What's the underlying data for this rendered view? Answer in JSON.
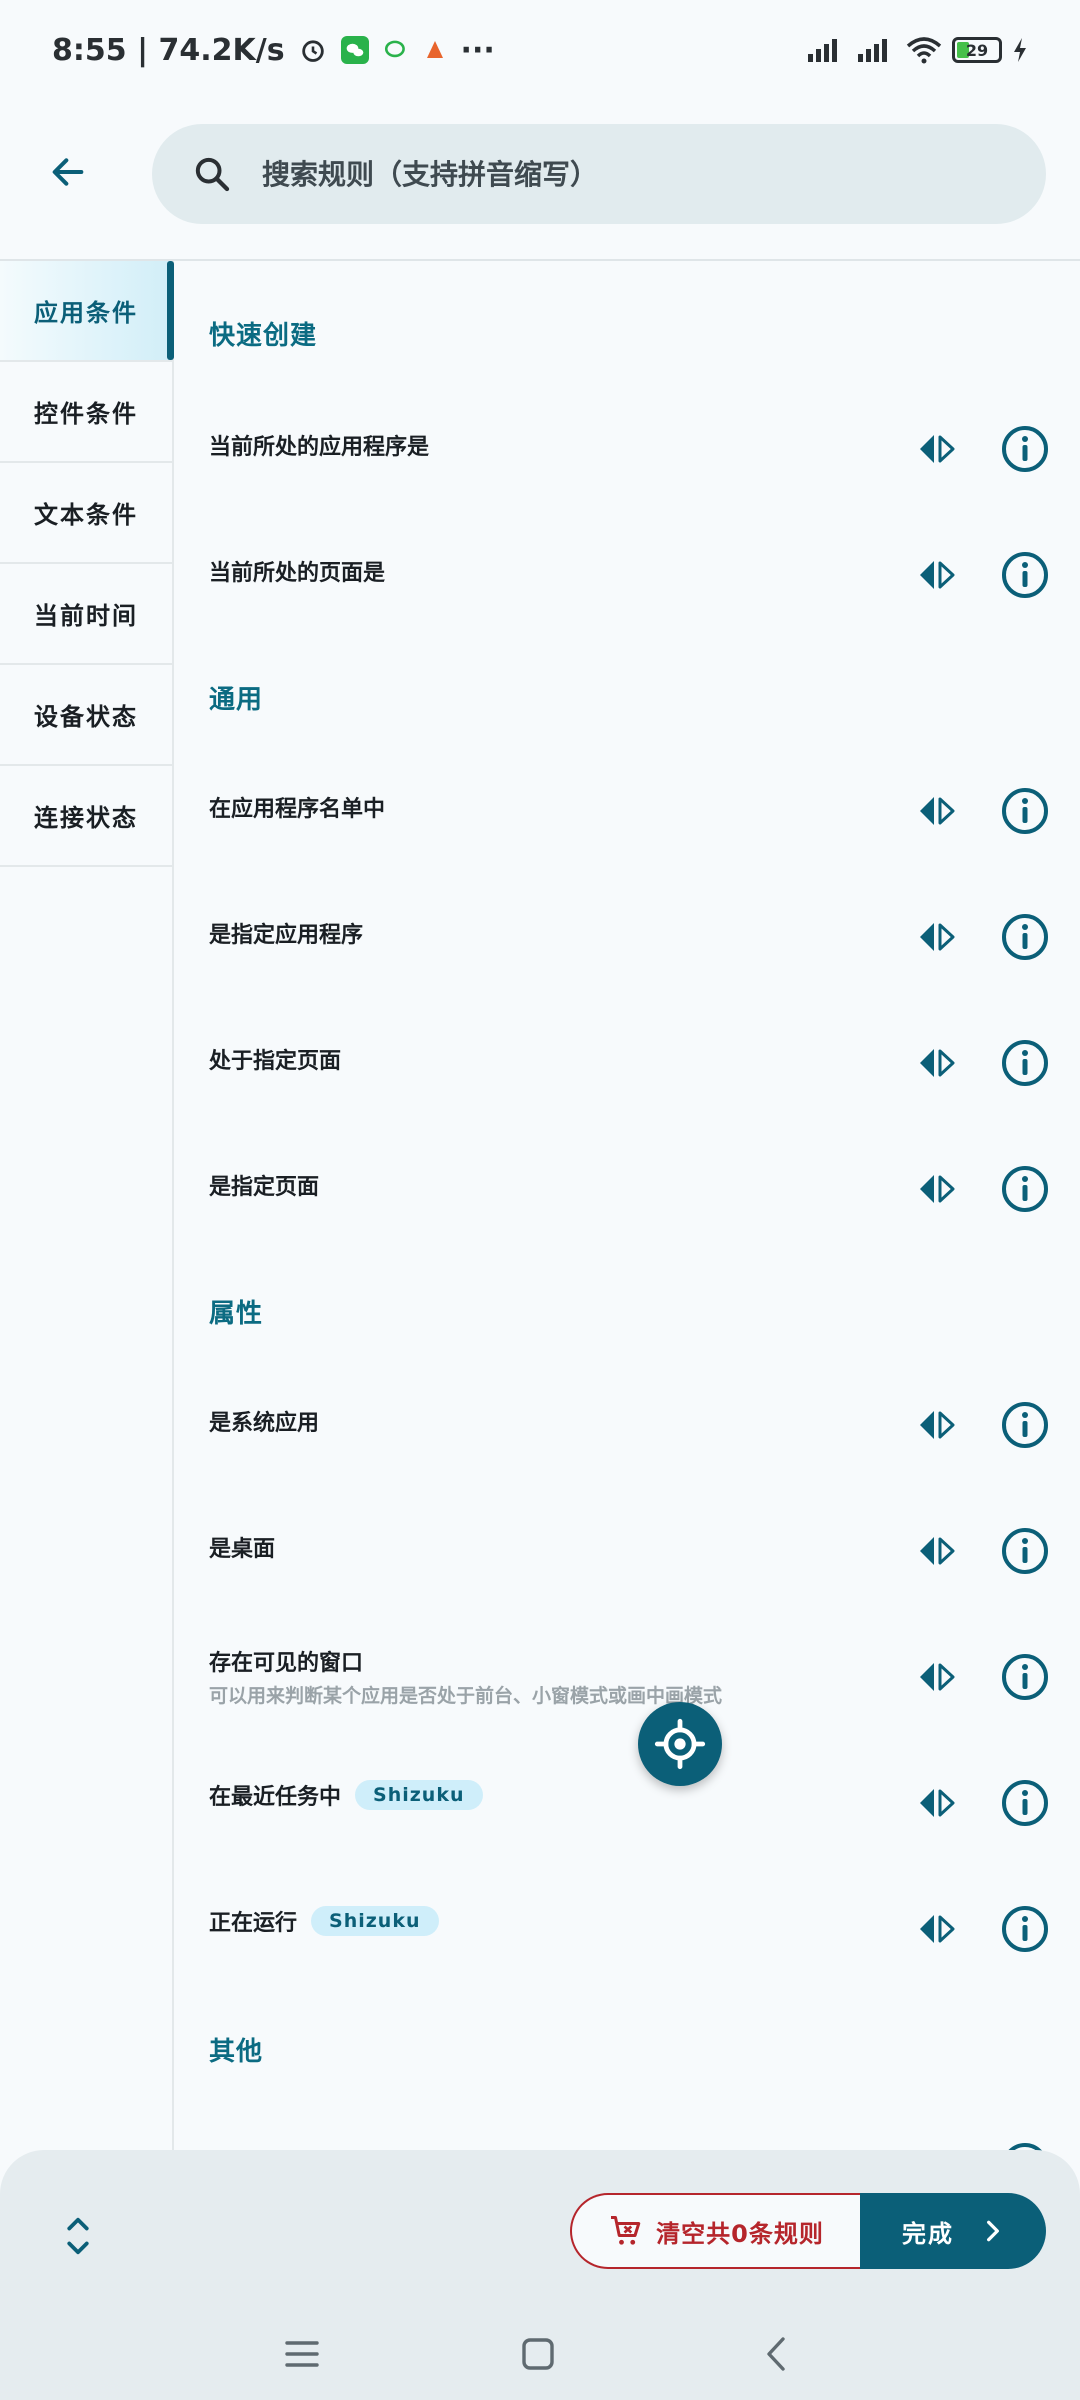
{
  "status_bar": {
    "time_speed": "8:55 | 74.2K/s",
    "more": "···",
    "battery": "29"
  },
  "header": {
    "search_placeholder": "搜索规则（支持拼音缩写）"
  },
  "sidebar": {
    "items": [
      {
        "label": "应用条件"
      },
      {
        "label": "控件条件"
      },
      {
        "label": "文本条件"
      },
      {
        "label": "当前时间"
      },
      {
        "label": "设备状态"
      },
      {
        "label": "连接状态"
      }
    ]
  },
  "main": {
    "sections": {
      "quick": "快速创建",
      "general": "通用",
      "attributes": "属性",
      "other": "其他"
    },
    "rows": [
      {
        "label": "当前所处的应用程序是"
      },
      {
        "label": "当前所处的页面是"
      },
      {
        "label": "在应用程序名单中"
      },
      {
        "label": "是指定应用程序"
      },
      {
        "label": "处于指定页面"
      },
      {
        "label": "是指定页面"
      },
      {
        "label": "是系统应用"
      },
      {
        "label": "是桌面"
      },
      {
        "label": "存在可见的窗口",
        "sub": "可以用来判断某个应用是否处于前台、小窗模式或画中画模式"
      },
      {
        "label": "在最近任务中",
        "badge": "Shizuku"
      },
      {
        "label": "正在运行",
        "badge": "Shizuku"
      }
    ]
  },
  "bottom": {
    "clear_label": "清空共0条规则",
    "done_label": "完成"
  },
  "colors": {
    "accent": "#0b5f78",
    "danger": "#b5252b",
    "badge_bg": "#cfeefa"
  }
}
